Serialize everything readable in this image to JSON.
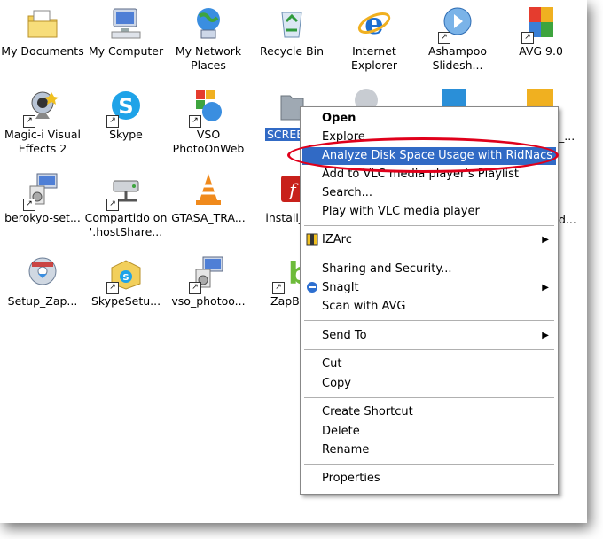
{
  "desktop_icons": [
    {
      "label": "My Documents",
      "icon": "my-documents-icon"
    },
    {
      "label": "My Computer",
      "icon": "my-computer-icon"
    },
    {
      "label": "My Network\nPlaces",
      "icon": "network-places-icon"
    },
    {
      "label": "Recycle Bin",
      "icon": "recycle-bin-icon"
    },
    {
      "label": "Internet\nExplorer",
      "icon": "internet-explorer-icon"
    },
    {
      "label": "Ashampoo\nSlidesh...",
      "icon": "ashampoo-icon"
    },
    {
      "label": "AVG 9.0",
      "icon": "avg-icon"
    },
    {
      "label": "Magic-i Visual\nEffects 2",
      "icon": "webcam-icon"
    },
    {
      "label": "Skype",
      "icon": "skype-icon"
    },
    {
      "label": "VSO\nPhotoOnWeb",
      "icon": "vso-photo-icon"
    },
    {
      "label": "SCREE",
      "icon": "folder-icon"
    },
    {
      "label": "berokyo-set...",
      "icon": "installer-icon"
    },
    {
      "label": "Compartido on\n'.hostShare...",
      "icon": "network-drive-icon"
    },
    {
      "label": "GTASA_TRA...",
      "icon": "vlc-cone-icon"
    },
    {
      "label": "install_fla",
      "icon": "flash-icon"
    },
    {
      "label": "Setup_Zap...",
      "icon": "setup-disc-icon"
    },
    {
      "label": "SkypeSetu...",
      "icon": "skype-setup-icon"
    },
    {
      "label": "vso_photoo...",
      "icon": "vso-installer-icon"
    },
    {
      "label": "ZapBi",
      "icon": "zapbi-icon"
    }
  ],
  "partial_labels": {
    "row2": "_...",
    "row3": "d..."
  },
  "context_menu": {
    "open": "Open",
    "explore": "Explore",
    "analyze": "Analyze Disk Space Usage with RidNacs",
    "vlc_playlist": "Add to VLC media player's Playlist",
    "search": "Search...",
    "vlc_play": "Play with VLC media player",
    "izarc": "IZArc",
    "sharing": "Sharing and Security...",
    "snagit": "SnagIt",
    "scan_avg": "Scan with AVG",
    "send_to": "Send To",
    "cut": "Cut",
    "copy": "Copy",
    "create_shortcut": "Create Shortcut",
    "delete": "Delete",
    "rename": "Rename",
    "properties": "Properties",
    "submenu_arrow": "▶"
  },
  "colors": {
    "highlight": "#316ac5",
    "annotation": "#e0001b"
  }
}
